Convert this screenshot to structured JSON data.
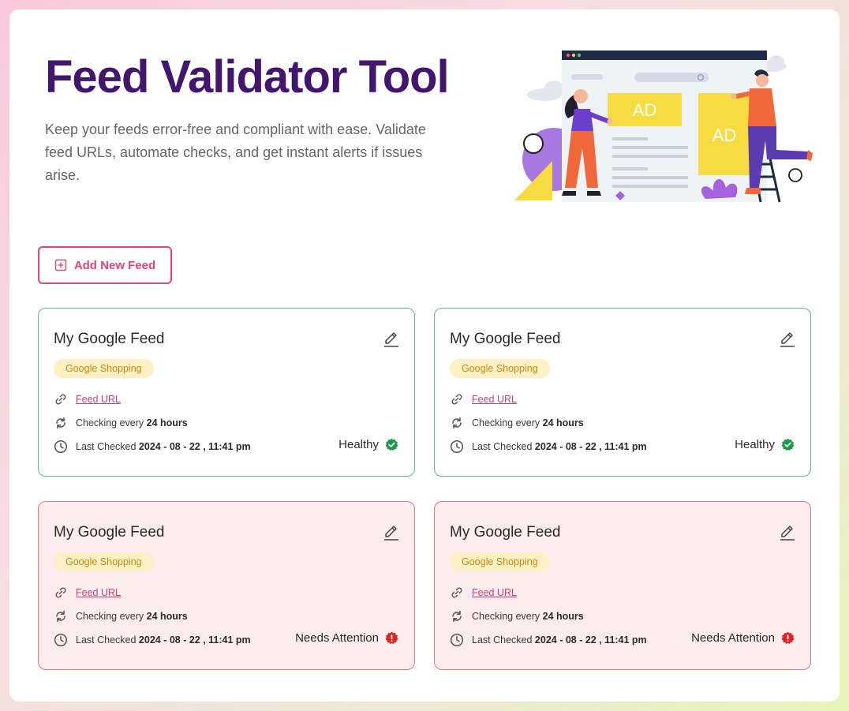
{
  "hero": {
    "title": "Feed Validator Tool",
    "subtitle": "Keep your feeds error-free and compliant with ease. Validate feed URLs, automate checks, and get instant alerts if issues arise.",
    "illustration_ad_label": "AD"
  },
  "actions": {
    "add_feed_label": "Add New Feed"
  },
  "colors": {
    "brand": "#43166e",
    "accent": "#e0457b",
    "healthy": "#1a9a4b",
    "attention": "#e02424"
  },
  "feeds": [
    {
      "name": "My Google Feed",
      "channel": "Google Shopping",
      "url_label": "Feed URL",
      "checking_prefix": "Checking every",
      "interval": "24 hours",
      "last_checked_prefix": "Last Checked",
      "last_checked": "2024 - 08 - 22 , 11:41 pm",
      "status": "Healthy",
      "status_icon": "check-badge-icon"
    },
    {
      "name": "My Google Feed",
      "channel": "Google Shopping",
      "url_label": "Feed URL",
      "checking_prefix": "Checking every",
      "interval": "24 hours",
      "last_checked_prefix": "Last Checked",
      "last_checked": "2024 - 08 - 22 , 11:41 pm",
      "status": "Healthy",
      "status_icon": "check-badge-icon"
    },
    {
      "name": "My Google Feed",
      "channel": "Google Shopping",
      "url_label": "Feed URL",
      "checking_prefix": "Checking every",
      "interval": "24 hours",
      "last_checked_prefix": "Last Checked",
      "last_checked": "2024 - 08 - 22 , 11:41 pm",
      "status": "Needs Attention",
      "status_icon": "alert-badge-icon"
    },
    {
      "name": "My Google Feed",
      "channel": "Google Shopping",
      "url_label": "Feed URL",
      "checking_prefix": "Checking every",
      "interval": "24 hours",
      "last_checked_prefix": "Last Checked",
      "last_checked": "2024 - 08 - 22 , 11:41 pm",
      "status": "Needs Attention",
      "status_icon": "alert-badge-icon"
    }
  ]
}
